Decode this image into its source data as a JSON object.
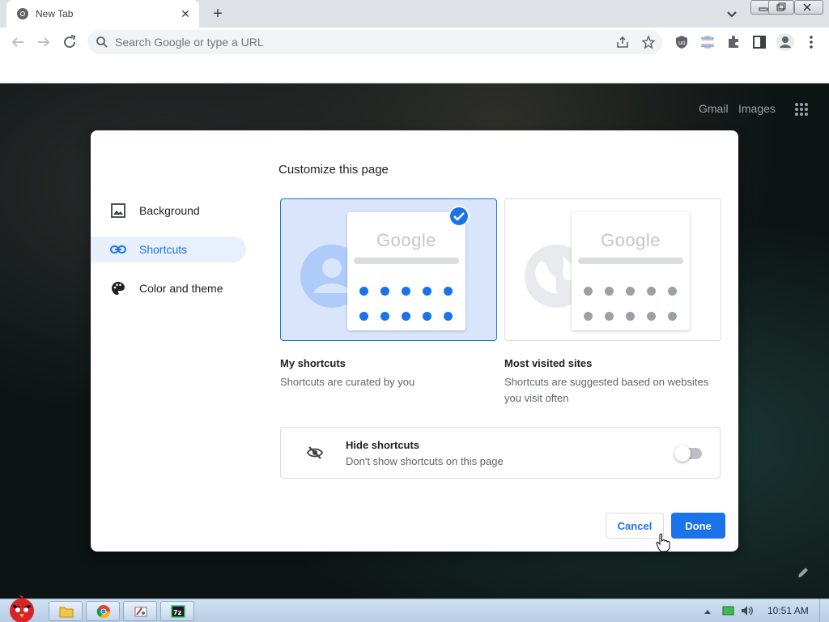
{
  "browser": {
    "tab_title": "New Tab",
    "omnibox_placeholder": "Search Google or type a URL"
  },
  "ntp": {
    "gmail_label": "Gmail",
    "images_label": "Images"
  },
  "dialog": {
    "title": "Customize this page",
    "nav": [
      {
        "label": "Background",
        "icon": "image-icon"
      },
      {
        "label": "Shortcuts",
        "icon": "link-icon"
      },
      {
        "label": "Color and theme",
        "icon": "palette-icon"
      }
    ],
    "selected_nav": "Shortcuts",
    "options": [
      {
        "title": "My shortcuts",
        "desc_line1": "Shortcuts are curated by you",
        "desc_line2": "",
        "selected": true,
        "logo": "Google"
      },
      {
        "title": "Most visited sites",
        "desc_line1": "Shortcuts are suggested based on websites",
        "desc_line2": "you visit often",
        "selected": false,
        "logo": "Google"
      }
    ],
    "hide_shortcuts": {
      "title": "Hide shortcuts",
      "desc": "Don't show shortcuts on this page",
      "enabled": false
    },
    "cancel_label": "Cancel",
    "done_label": "Done"
  },
  "taskbar": {
    "clock": "10:51 AM",
    "apps": [
      "folder-icon",
      "chrome-icon",
      "paint-icon",
      "7zip-icon"
    ]
  },
  "colors": {
    "accent": "#1a73e8",
    "selected_bg": "#d9e5fb"
  }
}
